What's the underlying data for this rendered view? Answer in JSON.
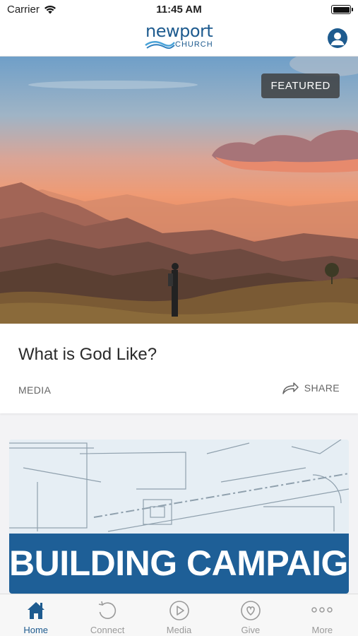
{
  "status_bar": {
    "carrier": "Carrier",
    "time": "11:45 AM"
  },
  "header": {
    "logo_word": "newport",
    "logo_sub": "CHURCH"
  },
  "featured": {
    "badge": "FEATURED",
    "title": "What is God Like?",
    "category": "MEDIA",
    "share_label": "SHARE"
  },
  "campaign": {
    "title": "BUILDING CAMPAIGN"
  },
  "tabs": [
    {
      "label": "Home",
      "icon": "home-icon",
      "active": true
    },
    {
      "label": "Connect",
      "icon": "refresh-icon",
      "active": false
    },
    {
      "label": "Media",
      "icon": "play-icon",
      "active": false
    },
    {
      "label": "Give",
      "icon": "heart-icon",
      "active": false
    },
    {
      "label": "More",
      "icon": "more-icon",
      "active": false
    }
  ],
  "colors": {
    "brand": "#1e5b8f",
    "banner": "#1e5f97",
    "inactive": "#9a9a9a"
  }
}
